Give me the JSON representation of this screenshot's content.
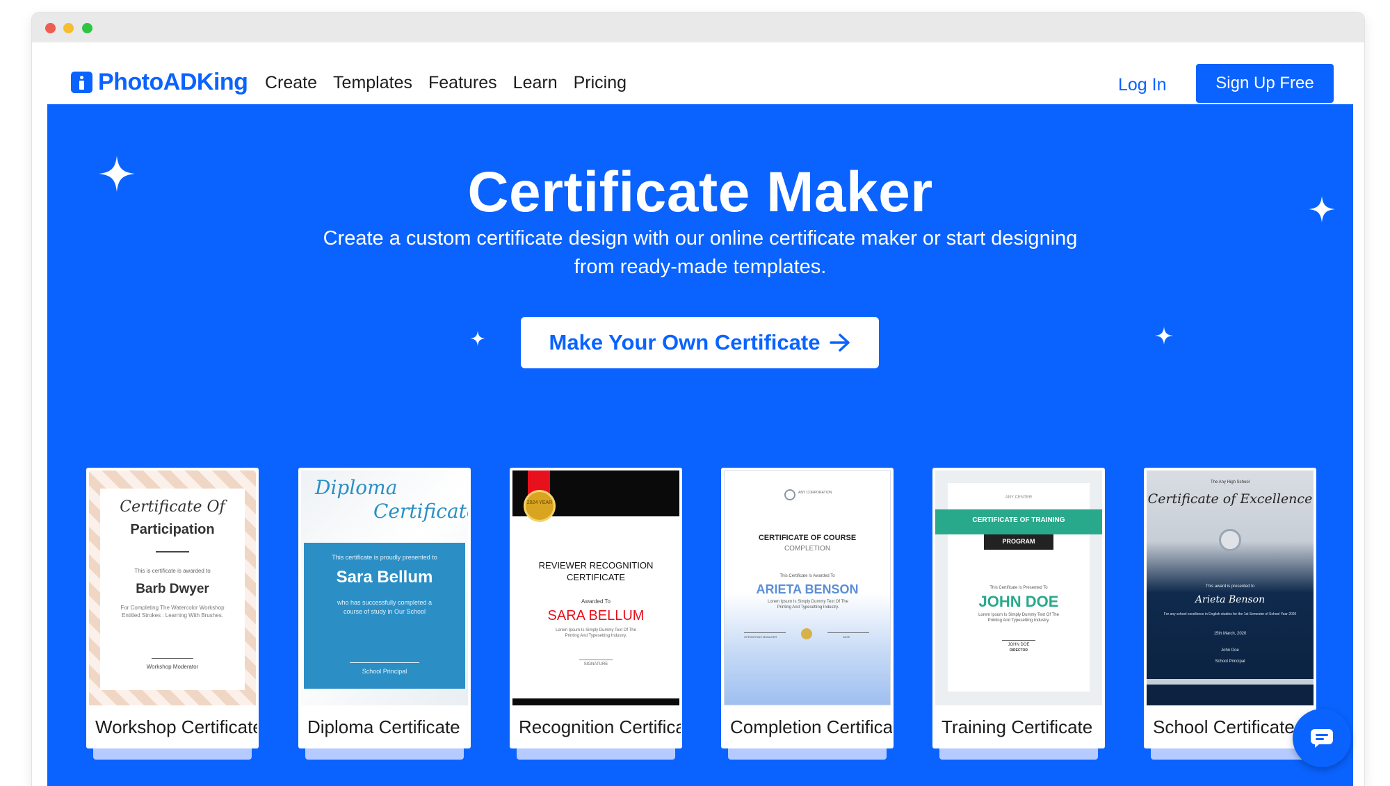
{
  "nav": {
    "logo_text": "PhotoADKing",
    "menu": [
      "Create",
      "Templates",
      "Features",
      "Learn",
      "Pricing"
    ],
    "login": "Log In",
    "signup": "Sign Up Free"
  },
  "hero": {
    "title": "Certificate Maker",
    "subtitle": "Create a custom certificate design with our online certificate maker or start designing from ready-made templates.",
    "cta": "Make Your Own Certificate"
  },
  "cards": [
    {
      "label": "Workshop Certificate",
      "heading_script": "Certificate Of",
      "heading": "Participation",
      "awarded": "This is certificate is awarded to",
      "name": "Barb Dwyer",
      "desc": "For Completing The Watercolor Workshop Entitled Strokes : Learning With Brushes.",
      "signer": "Workshop Moderator"
    },
    {
      "label": "Diploma Certificate",
      "script_1": "Diploma",
      "script_2": "Certificate",
      "presented": "This certificate is proudly presented to",
      "name": "Sara Bellum",
      "desc": "who has successfully completed a course of study in Our School",
      "signer": "School Principal"
    },
    {
      "label": "Recognition Certificate",
      "badge": "2024 YEAR",
      "title": "REVIEWER RECOGNITION CERTIFICATE",
      "awarded": "Awarded To",
      "name": "SARA BELLUM",
      "desc": "Lorem Ipsum Is Simply Dummy Text Of The Printing And Typesetting Industry.",
      "signer": "SIGNATURE"
    },
    {
      "label": "Completion Certificate",
      "org": "ANY CORPORATION",
      "title": "CERTIFICATE OF COURSE",
      "subtitle": "COMPLETION",
      "awarded": "This Certificate Is Awarded To",
      "name": "ARIETA BENSON",
      "desc": "Lorem Ipsum Is Simply Dummy Text Of The Printing And Typesetting Industry.",
      "signer_1": "OPERATIONS MANAGER",
      "signer_2": "DATE"
    },
    {
      "label": "Training Certificate",
      "org": "ANY CENTER",
      "ribbon_1": "CERTIFICATE OF TRAINING",
      "ribbon_2": "PROGRAM",
      "presented": "This Certificate Is Presented To",
      "name": "JOHN DOE",
      "desc": "Lorem Ipsum Is Simply Dummy Text Of The Printing And Typesetting Industry.",
      "signer": "JOHN DOE",
      "signer_role": "DIRECTOR"
    },
    {
      "label": "School Certificate",
      "org": "The Any High School",
      "title": "Certificate of Excellence",
      "presented": "This award is presented to",
      "name": "Arieta Benson",
      "desc": "For any school excellence in English studies for the 1st Semester of School Year 2020",
      "date": "15th March, 2020",
      "signer": "John Doe",
      "signer_role": "School Principal"
    }
  ],
  "colors": {
    "brand_blue": "#0a63ff",
    "recognition_red": "#e8101c",
    "training_teal": "#29a98b",
    "school_navy": "#0f2a4d"
  },
  "icons": {
    "cta": "arrow-right-icon",
    "chat": "chat-icon",
    "decor": "sparkle-icon"
  }
}
